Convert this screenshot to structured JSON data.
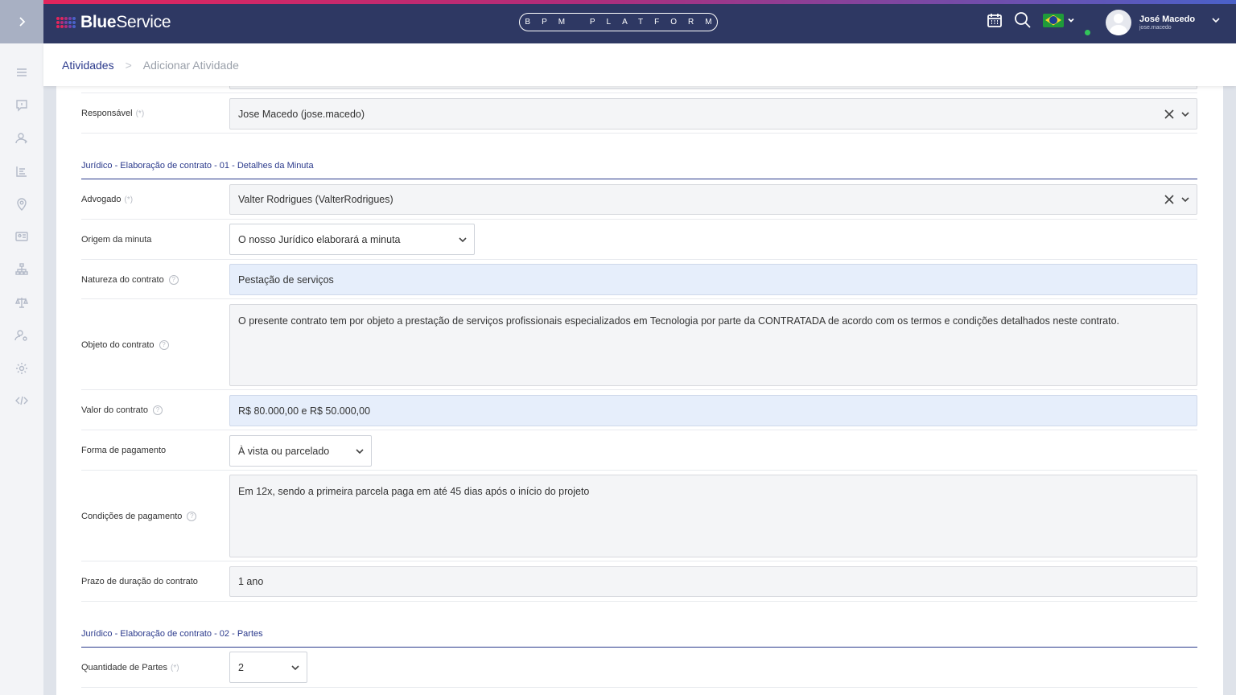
{
  "header": {
    "brand_bold": "Blue",
    "brand_light": "Service",
    "platform": "BPM PLATFORM",
    "user_name": "José Macedo",
    "user_login": "jose.macedo",
    "icons": [
      "calendar-icon",
      "search-icon",
      "brazil-flag-icon",
      "chevron-down-icon"
    ],
    "accent_colors": [
      "#e3255c",
      "#4a61c9"
    ],
    "bar_color": "#2e3863"
  },
  "breadcrumb": {
    "parent": "Atividades",
    "current": "Adicionar Atividade"
  },
  "sidebar": {
    "icons": [
      "menu-icon",
      "comment-icon",
      "user-share-icon",
      "list-icon",
      "location-icon",
      "id-card-icon",
      "hierarchy-icon",
      "scale-icon",
      "user-settings-icon",
      "gear-icon",
      "code-icon"
    ]
  },
  "form": {
    "responsavel": {
      "label": "Responsável",
      "req": "(*)",
      "value": "Jose Macedo (jose.macedo)"
    },
    "section1": "Jurídico - Elaboração de contrato - 01 - Detalhes da Minuta",
    "advogado": {
      "label": "Advogado",
      "req": "(*)",
      "value": "Valter Rodrigues (ValterRodrigues)"
    },
    "origem": {
      "label": "Origem da minuta",
      "value": "O nosso Jurídico elaborará a minuta"
    },
    "natureza": {
      "label": "Natureza do contrato",
      "value": "Pestação de serviços"
    },
    "objeto": {
      "label": "Objeto do contrato",
      "value": "O presente contrato tem por objeto a prestação de serviços profissionais especializados em Tecnologia por parte da CONTRATADA de acordo com os termos e condições detalhados neste contrato."
    },
    "valor": {
      "label": "Valor do contrato",
      "value": "R$ 80.000,00 e R$ 50.000,00"
    },
    "forma": {
      "label": "Forma de pagamento",
      "value": "À vista ou parcelado"
    },
    "condicoes": {
      "label": "Condições de pagamento",
      "value": "Em 12x, sendo a primeira parcela paga em até 45 dias após o início do projeto"
    },
    "prazo": {
      "label": "Prazo de duração do contrato",
      "value": "1 ano"
    },
    "section2": "Jurídico - Elaboração de contrato - 02 - Partes",
    "quantidade": {
      "label": "Quantidade de Partes",
      "req": "(*)",
      "value": "2"
    }
  }
}
